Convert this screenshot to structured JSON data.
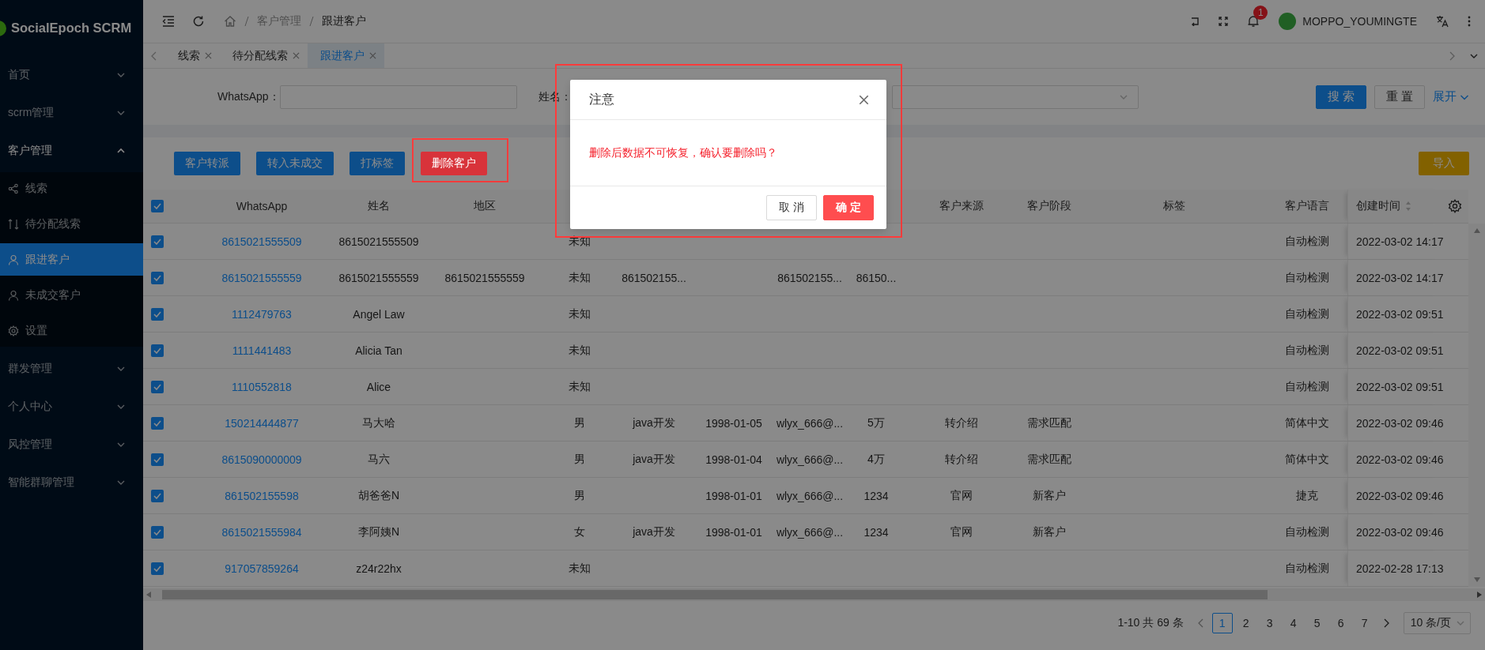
{
  "sidebar": {
    "logo": "SocialEpoch SCRM",
    "items": [
      {
        "label": "首页",
        "expanded": false
      },
      {
        "label": "scrm管理",
        "expanded": false
      },
      {
        "label": "客户管理",
        "expanded": true,
        "children": [
          {
            "label": "线索",
            "kind": "share",
            "selected": false
          },
          {
            "label": "待分配线索",
            "kind": "branch",
            "selected": false
          },
          {
            "label": "跟进客户",
            "kind": "user",
            "selected": true
          },
          {
            "label": "未成交客户",
            "kind": "user",
            "selected": false
          },
          {
            "label": "设置",
            "kind": "gear",
            "selected": false
          }
        ]
      },
      {
        "label": "群发管理",
        "expanded": false
      },
      {
        "label": "个人中心",
        "expanded": false
      },
      {
        "label": "风控管理",
        "expanded": false
      },
      {
        "label": "智能群聊管理",
        "expanded": false
      }
    ]
  },
  "header": {
    "breadcrumb": [
      "客户管理",
      "跟进客户"
    ],
    "notifications": "1",
    "user": "MOPPO_YOUMINGTE"
  },
  "tabs": [
    {
      "label": "线索",
      "selected": false
    },
    {
      "label": "待分配线索",
      "selected": false
    },
    {
      "label": "跟进客户",
      "selected": true
    }
  ],
  "filters": {
    "fields": [
      {
        "kind": "input",
        "label": "WhatsApp："
      },
      {
        "kind": "label",
        "label": "姓名："
      },
      {
        "kind": "select"
      }
    ],
    "buttons": [
      {
        "label": "搜 索",
        "kind": "primary"
      },
      {
        "label": "重 置",
        "kind": "default"
      }
    ],
    "expand_link": "展开"
  },
  "actions": [
    {
      "label": "客户转派",
      "kind": "primary",
      "highlighted": false
    },
    {
      "label": "转入未成交",
      "kind": "primary",
      "highlighted": false
    },
    {
      "label": "打标签",
      "kind": "primary",
      "highlighted": false
    },
    {
      "label": "删除客户",
      "kind": "danger",
      "highlighted": true
    }
  ],
  "import_button": "导入",
  "table": {
    "all_checked": true,
    "headers": {
      "whatsapp": "WhatsApp",
      "name": "姓名",
      "region": "地区",
      "source": "客户来源",
      "stage": "客户阶段",
      "tags": "标签",
      "language": "客户语言",
      "created": "创建时间"
    },
    "rows": [
      {
        "checked": true,
        "whatsapp": "8615021555509",
        "name": "8615021555509",
        "column_4": "未知",
        "language": "自动检测",
        "created": "2022-03-02 14:17"
      },
      {
        "checked": true,
        "whatsapp": "8615021555559",
        "name": "8615021555559",
        "region": "8615021555559",
        "column_4": "未知",
        "column_5": "861502155...",
        "column_7": "861502155...",
        "column_8": "86150...",
        "language": "自动检测",
        "created": "2022-03-02 14:17"
      },
      {
        "checked": true,
        "whatsapp": "1112479763",
        "name": "Angel Law",
        "column_4": "未知",
        "language": "自动检测",
        "created": "2022-03-02 09:51"
      },
      {
        "checked": true,
        "whatsapp": "1111441483",
        "name": "Alicia Tan",
        "column_4": "未知",
        "language": "自动检测",
        "created": "2022-03-02 09:51"
      },
      {
        "checked": true,
        "whatsapp": "1110552818",
        "name": "Alice",
        "column_4": "未知",
        "language": "自动检测",
        "created": "2022-03-02 09:51"
      },
      {
        "checked": true,
        "whatsapp": "150214444877",
        "name": "马大哈",
        "column_4": "男",
        "column_5": "java开发",
        "column_6": "1998-01-05",
        "column_7": "wlyx_666@...",
        "column_8": "5万",
        "source": "转介绍",
        "stage": "需求匹配",
        "language": "简体中文",
        "created": "2022-03-02 09:46"
      },
      {
        "checked": true,
        "whatsapp": "8615090000009",
        "name": "马六",
        "column_4": "男",
        "column_5": "java开发",
        "column_6": "1998-01-04",
        "column_7": "wlyx_666@...",
        "column_8": "4万",
        "source": "转介绍",
        "stage": "需求匹配",
        "language": "简体中文",
        "created": "2022-03-02 09:46"
      },
      {
        "checked": true,
        "whatsapp": "861502155598",
        "name": "胡爸爸N",
        "column_4": "男",
        "column_6": "1998-01-01",
        "column_7": "wlyx_666@...",
        "column_8": "1234",
        "source": "官网",
        "stage": "新客户",
        "language": "捷克",
        "created": "2022-03-02 09:46"
      },
      {
        "checked": true,
        "whatsapp": "8615021555984",
        "name": "李阿姨N",
        "column_4": "女",
        "column_5": "java开发",
        "column_6": "1998-01-01",
        "column_7": "wlyx_666@...",
        "column_8": "1234",
        "source": "官网",
        "stage": "新客户",
        "language": "自动检测",
        "created": "2022-03-02 09:46"
      },
      {
        "checked": true,
        "whatsapp": "917057859264",
        "name": "z24r22hx",
        "column_4": "未知",
        "language": "自动检测",
        "created": "2022-02-28 17:13"
      }
    ]
  },
  "pagination": {
    "summary": "1-10 共 69 条",
    "pages": [
      {
        "label": "1",
        "selected": true
      },
      {
        "label": "2",
        "selected": false
      },
      {
        "label": "3",
        "selected": false
      },
      {
        "label": "4",
        "selected": false
      },
      {
        "label": "5",
        "selected": false
      },
      {
        "label": "6",
        "selected": false
      },
      {
        "label": "7",
        "selected": false
      }
    ],
    "page_size": "10 条/页"
  },
  "modal": {
    "title": "注意",
    "message": "删除后数据不可恢复，确认要删除吗？",
    "highlighted": true,
    "buttons": [
      {
        "label": "取 消",
        "kind": "default"
      },
      {
        "label": "确 定",
        "kind": "danger"
      }
    ]
  }
}
